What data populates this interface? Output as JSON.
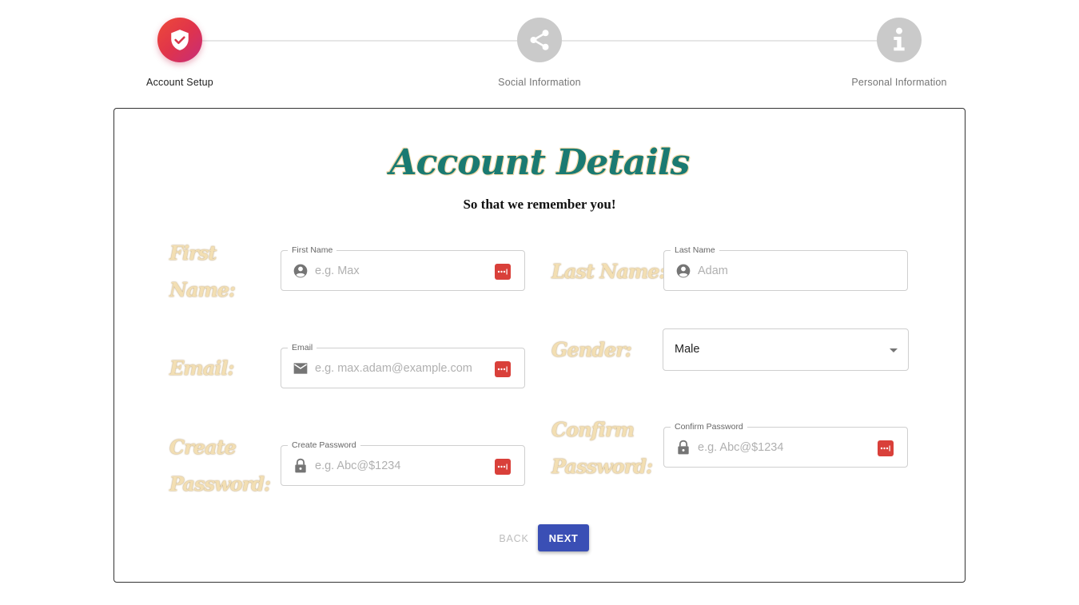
{
  "stepper": {
    "steps": [
      {
        "label": "Account Setup",
        "icon": "shield-check-icon",
        "state": "active"
      },
      {
        "label": "Social Information",
        "icon": "share-icon",
        "state": "inactive"
      },
      {
        "label": "Personal Information",
        "icon": "info-icon",
        "state": "inactive"
      }
    ]
  },
  "form": {
    "title": "Account Details",
    "subtitle": "So that we remember you!",
    "labels": {
      "first_name_1": "First",
      "first_name_2": "Name:",
      "last_name": "Last Name:",
      "email": "Email:",
      "gender": "Gender:",
      "create_password_1": "Create",
      "create_password_2": "Password:",
      "confirm_password_1": "Confirm",
      "confirm_password_2": "Password:"
    },
    "fields": {
      "first_name": {
        "legend": "First Name",
        "placeholder": "e.g. Max",
        "value": "",
        "icon": "account-circle-icon"
      },
      "last_name": {
        "legend": "Last Name",
        "placeholder": "Adam",
        "value": "",
        "icon": "account-circle-icon"
      },
      "email": {
        "legend": "Email",
        "placeholder": "e.g. max.adam@example.com",
        "value": "",
        "icon": "mail-icon"
      },
      "gender": {
        "selected": "Male"
      },
      "create_password": {
        "legend": "Create Password",
        "placeholder": "e.g. Abc@$1234",
        "value": "",
        "icon": "lock-icon"
      },
      "confirm_password": {
        "legend": "Confirm Password",
        "placeholder": "e.g. Abc@$1234",
        "value": "",
        "icon": "lock-icon"
      }
    }
  },
  "buttons": {
    "back": "BACK",
    "next": "NEXT"
  },
  "colors": {
    "accent": "#3a4fb5",
    "title": "#1a7a72",
    "active_step_start": "#ee4a38",
    "active_step_end": "#c62d7a",
    "inactive_step": "#cacaca",
    "password_manager": "#d9403a"
  }
}
